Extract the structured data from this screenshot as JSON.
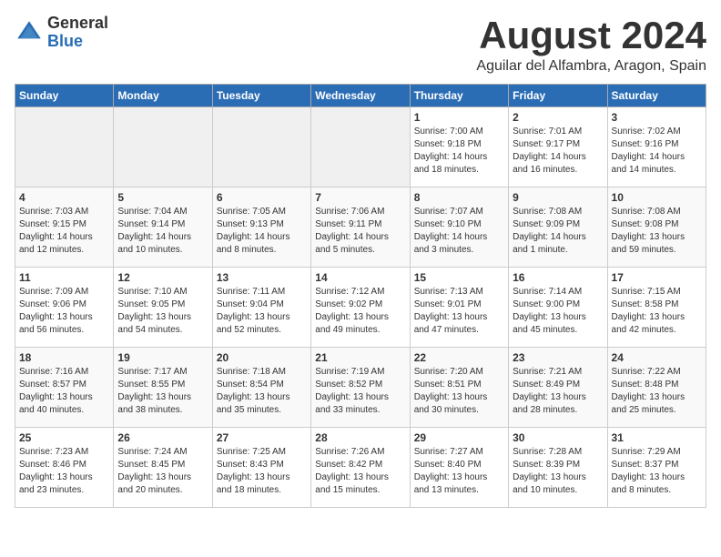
{
  "header": {
    "logo_general": "General",
    "logo_blue": "Blue",
    "month": "August 2024",
    "location": "Aguilar del Alfambra, Aragon, Spain"
  },
  "weekdays": [
    "Sunday",
    "Monday",
    "Tuesday",
    "Wednesday",
    "Thursday",
    "Friday",
    "Saturday"
  ],
  "weeks": [
    [
      {
        "day": "",
        "empty": true
      },
      {
        "day": "",
        "empty": true
      },
      {
        "day": "",
        "empty": true
      },
      {
        "day": "",
        "empty": true
      },
      {
        "day": "1",
        "sunrise": "7:00 AM",
        "sunset": "9:18 PM",
        "daylight": "14 hours and 18 minutes."
      },
      {
        "day": "2",
        "sunrise": "7:01 AM",
        "sunset": "9:17 PM",
        "daylight": "14 hours and 16 minutes."
      },
      {
        "day": "3",
        "sunrise": "7:02 AM",
        "sunset": "9:16 PM",
        "daylight": "14 hours and 14 minutes."
      }
    ],
    [
      {
        "day": "4",
        "sunrise": "7:03 AM",
        "sunset": "9:15 PM",
        "daylight": "14 hours and 12 minutes."
      },
      {
        "day": "5",
        "sunrise": "7:04 AM",
        "sunset": "9:14 PM",
        "daylight": "14 hours and 10 minutes."
      },
      {
        "day": "6",
        "sunrise": "7:05 AM",
        "sunset": "9:13 PM",
        "daylight": "14 hours and 8 minutes."
      },
      {
        "day": "7",
        "sunrise": "7:06 AM",
        "sunset": "9:11 PM",
        "daylight": "14 hours and 5 minutes."
      },
      {
        "day": "8",
        "sunrise": "7:07 AM",
        "sunset": "9:10 PM",
        "daylight": "14 hours and 3 minutes."
      },
      {
        "day": "9",
        "sunrise": "7:08 AM",
        "sunset": "9:09 PM",
        "daylight": "14 hours and 1 minute."
      },
      {
        "day": "10",
        "sunrise": "7:08 AM",
        "sunset": "9:08 PM",
        "daylight": "13 hours and 59 minutes."
      }
    ],
    [
      {
        "day": "11",
        "sunrise": "7:09 AM",
        "sunset": "9:06 PM",
        "daylight": "13 hours and 56 minutes."
      },
      {
        "day": "12",
        "sunrise": "7:10 AM",
        "sunset": "9:05 PM",
        "daylight": "13 hours and 54 minutes."
      },
      {
        "day": "13",
        "sunrise": "7:11 AM",
        "sunset": "9:04 PM",
        "daylight": "13 hours and 52 minutes."
      },
      {
        "day": "14",
        "sunrise": "7:12 AM",
        "sunset": "9:02 PM",
        "daylight": "13 hours and 49 minutes."
      },
      {
        "day": "15",
        "sunrise": "7:13 AM",
        "sunset": "9:01 PM",
        "daylight": "13 hours and 47 minutes."
      },
      {
        "day": "16",
        "sunrise": "7:14 AM",
        "sunset": "9:00 PM",
        "daylight": "13 hours and 45 minutes."
      },
      {
        "day": "17",
        "sunrise": "7:15 AM",
        "sunset": "8:58 PM",
        "daylight": "13 hours and 42 minutes."
      }
    ],
    [
      {
        "day": "18",
        "sunrise": "7:16 AM",
        "sunset": "8:57 PM",
        "daylight": "13 hours and 40 minutes."
      },
      {
        "day": "19",
        "sunrise": "7:17 AM",
        "sunset": "8:55 PM",
        "daylight": "13 hours and 38 minutes."
      },
      {
        "day": "20",
        "sunrise": "7:18 AM",
        "sunset": "8:54 PM",
        "daylight": "13 hours and 35 minutes."
      },
      {
        "day": "21",
        "sunrise": "7:19 AM",
        "sunset": "8:52 PM",
        "daylight": "13 hours and 33 minutes."
      },
      {
        "day": "22",
        "sunrise": "7:20 AM",
        "sunset": "8:51 PM",
        "daylight": "13 hours and 30 minutes."
      },
      {
        "day": "23",
        "sunrise": "7:21 AM",
        "sunset": "8:49 PM",
        "daylight": "13 hours and 28 minutes."
      },
      {
        "day": "24",
        "sunrise": "7:22 AM",
        "sunset": "8:48 PM",
        "daylight": "13 hours and 25 minutes."
      }
    ],
    [
      {
        "day": "25",
        "sunrise": "7:23 AM",
        "sunset": "8:46 PM",
        "daylight": "13 hours and 23 minutes."
      },
      {
        "day": "26",
        "sunrise": "7:24 AM",
        "sunset": "8:45 PM",
        "daylight": "13 hours and 20 minutes."
      },
      {
        "day": "27",
        "sunrise": "7:25 AM",
        "sunset": "8:43 PM",
        "daylight": "13 hours and 18 minutes."
      },
      {
        "day": "28",
        "sunrise": "7:26 AM",
        "sunset": "8:42 PM",
        "daylight": "13 hours and 15 minutes."
      },
      {
        "day": "29",
        "sunrise": "7:27 AM",
        "sunset": "8:40 PM",
        "daylight": "13 hours and 13 minutes."
      },
      {
        "day": "30",
        "sunrise": "7:28 AM",
        "sunset": "8:39 PM",
        "daylight": "13 hours and 10 minutes."
      },
      {
        "day": "31",
        "sunrise": "7:29 AM",
        "sunset": "8:37 PM",
        "daylight": "13 hours and 8 minutes."
      }
    ]
  ],
  "labels": {
    "sunrise": "Sunrise:",
    "sunset": "Sunset:",
    "daylight": "Daylight:"
  }
}
